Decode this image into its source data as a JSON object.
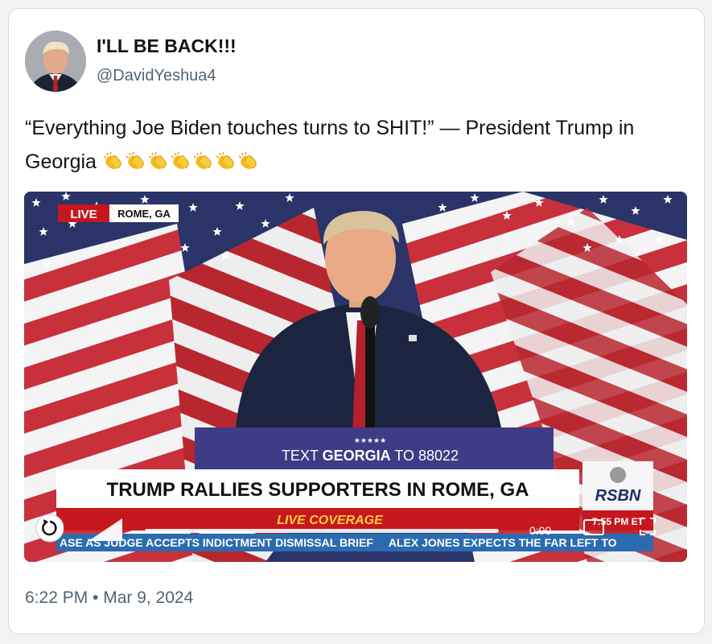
{
  "user": {
    "display_name": "I'LL BE BACK!!!",
    "handle": "@DavidYeshua4"
  },
  "tweet": {
    "text": "“Everything Joe Biden touches turns to SHIT!” — President Trump in Georgia",
    "emoji_icon": "clapping-hands-icon",
    "emoji_count": 7,
    "timestamp": "6:22 PM • Mar 9, 2024"
  },
  "video": {
    "live_badge": "LIVE",
    "location": "ROME, GA",
    "podium_stars": "★★★★★",
    "podium_text_prefix": "TEXT ",
    "podium_text_bold": "GEORGIA",
    "podium_text_suffix": " TO 88022",
    "headline": "TRUMP RALLIES SUPPORTERS IN ROME, GA",
    "live_coverage": "LIVE COVERAGE",
    "ticker": "ASE AS JUDGE ACCEPTS INDICTMENT DISMISSAL BRIEF     ALEX JONES EXPECTS THE FAR LEFT TO",
    "network_logo": "RSBN",
    "network_time": "7:55 PM ET",
    "player_time": "0:00",
    "colors": {
      "flag_red": "#b22234",
      "flag_blue": "#3c3b6e",
      "suit": "#1b2540",
      "banner_red": "#c7171e",
      "ticker_blue": "#2b6cb0"
    }
  }
}
